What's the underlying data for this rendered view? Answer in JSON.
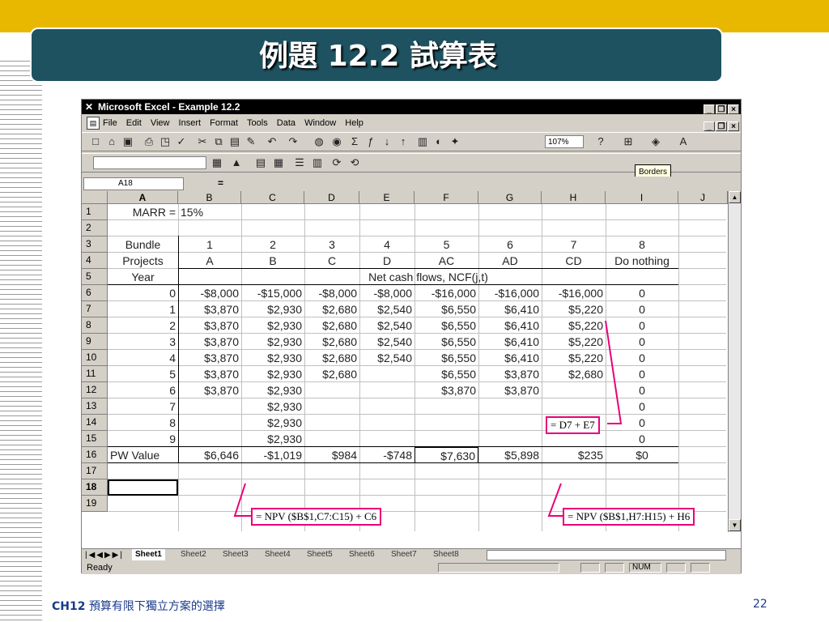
{
  "slide": {
    "title": "例題 12.2 試算表",
    "footer_chapter": "CH12",
    "footer_text": "預算有限下獨立方案的選擇",
    "page_number": "22",
    "colors": {
      "header_band": "#e8b800",
      "title_box": "#1e5260",
      "annotation_border": "#e8007a"
    }
  },
  "excel": {
    "app_title": "Microsoft Excel - Example 12.2",
    "menu": [
      "File",
      "Edit",
      "View",
      "Insert",
      "Format",
      "Tools",
      "Data",
      "Window",
      "Help"
    ],
    "zoom": "107%",
    "tooltip": "Borders",
    "name_box": "A18",
    "formula_eq": "=",
    "columns": [
      "A",
      "B",
      "C",
      "D",
      "E",
      "F",
      "G",
      "H",
      "I",
      "J"
    ],
    "row_numbers": [
      "1",
      "2",
      "3",
      "4",
      "5",
      "6",
      "7",
      "8",
      "9",
      "10",
      "11",
      "12",
      "13",
      "14",
      "15",
      "16",
      "17",
      "18",
      "19"
    ],
    "cells": {
      "r1": {
        "a": "MARR =",
        "b": "15%"
      },
      "r3": {
        "a": "Bundle",
        "b": "1",
        "c": "2",
        "d": "3",
        "e": "4",
        "f": "5",
        "g": "6",
        "h": "7",
        "i": "8"
      },
      "r4": {
        "a": "Projects",
        "b": "A",
        "c": "B",
        "d": "C",
        "e": "D",
        "f": "AC",
        "g": "AD",
        "h": "CD",
        "i": "Do nothing"
      },
      "r5": {
        "a": "Year",
        "span": "Net cash flows, NCF(j,t)"
      },
      "r6": {
        "a": "0",
        "b": "-$8,000",
        "c": "-$15,000",
        "d": "-$8,000",
        "e": "-$8,000",
        "f": "-$16,000",
        "g": "-$16,000",
        "h": "-$16,000",
        "i": "0"
      },
      "r7": {
        "a": "1",
        "b": "$3,870",
        "c": "$2,930",
        "d": "$2,680",
        "e": "$2,540",
        "f": "$6,550",
        "g": "$6,410",
        "h": "$5,220",
        "i": "0"
      },
      "r8": {
        "a": "2",
        "b": "$3,870",
        "c": "$2,930",
        "d": "$2,680",
        "e": "$2,540",
        "f": "$6,550",
        "g": "$6,410",
        "h": "$5,220",
        "i": "0"
      },
      "r9": {
        "a": "3",
        "b": "$3,870",
        "c": "$2,930",
        "d": "$2,680",
        "e": "$2,540",
        "f": "$6,550",
        "g": "$6,410",
        "h": "$5,220",
        "i": "0"
      },
      "r10": {
        "a": "4",
        "b": "$3,870",
        "c": "$2,930",
        "d": "$2,680",
        "e": "$2,540",
        "f": "$6,550",
        "g": "$6,410",
        "h": "$5,220",
        "i": "0"
      },
      "r11": {
        "a": "5",
        "b": "$3,870",
        "c": "$2,930",
        "d": "$2,680",
        "f": "$6,550",
        "g": "$3,870",
        "h": "$2,680",
        "i": "0"
      },
      "r12": {
        "a": "6",
        "b": "$3,870",
        "c": "$2,930",
        "f": "$3,870",
        "g": "$3,870",
        "i": "0"
      },
      "r13": {
        "a": "7",
        "c": "$2,930",
        "i": "0"
      },
      "r14": {
        "a": "8",
        "c": "$2,930",
        "i": "0"
      },
      "r15": {
        "a": "9",
        "c": "$2,930",
        "i": "0"
      },
      "r16": {
        "a": "PW Value",
        "b": "$6,646",
        "c": "-$1,019",
        "d": "$984",
        "e": "-$748",
        "f": "$7,630",
        "g": "$5,898",
        "h": "$235",
        "i": "$0"
      }
    },
    "annotations": {
      "d7e7": "= D7 + E7",
      "npv_c": "= NPV ($B$1,C7:C15) + C6",
      "npv_h": "= NPV ($B$1,H7:H15) + H6"
    },
    "sheet_tabs": [
      "Sheet1",
      "Sheet2",
      "Sheet3",
      "Sheet4",
      "Sheet5",
      "Sheet6",
      "Sheet7",
      "Sheet8"
    ],
    "status": {
      "ready": "Ready",
      "num": "NUM"
    }
  }
}
